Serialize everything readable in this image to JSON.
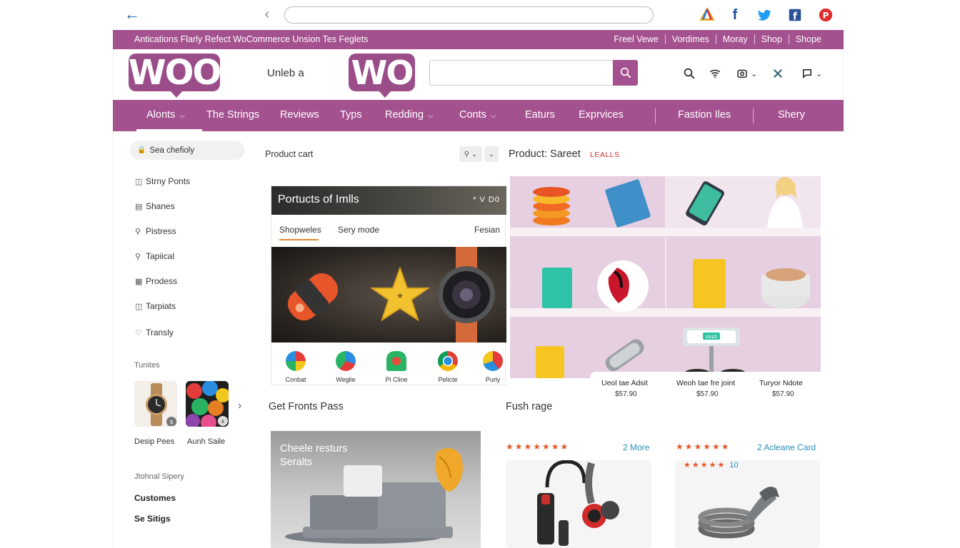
{
  "header": {
    "promo_text": "Antications Flarly Refect WoCommerce Unsion Tes Feglets",
    "top_links": [
      "Freel Vewe",
      "Vordimes",
      "Moray",
      "Shop",
      "Shope"
    ],
    "logo_text": "WOO",
    "logo_mid_text": "WO",
    "tagline": "Unleb a"
  },
  "nav": {
    "items": [
      {
        "label": "Alonts",
        "caret": true
      },
      {
        "label": "The Strings",
        "caret": false
      },
      {
        "label": "Reviews",
        "caret": false
      },
      {
        "label": "Typs",
        "caret": false
      },
      {
        "label": "Redding",
        "caret": true
      },
      {
        "label": "Conts",
        "caret": true
      },
      {
        "label": "Eaturs",
        "caret": false
      },
      {
        "label": "Exprvices",
        "caret": false
      },
      {
        "label": "Fastion Iles",
        "caret": false
      },
      {
        "label": "Shery",
        "caret": false
      }
    ]
  },
  "sidebar": {
    "search_label": "Sea chefioly",
    "items": [
      "Strny Ponts",
      "Shanes",
      "Pistress",
      "Tapiical",
      "Prodess",
      "Tarpiats",
      "Transly"
    ],
    "thumbs_heading": "Tunites",
    "thumbs": [
      {
        "label": "Desip Pees",
        "badge": "$"
      },
      {
        "label": "Aunh Saile",
        "badge": "x"
      }
    ],
    "bottom_heading": "Jtohnal Sipery",
    "bottom_links": [
      "Customes",
      "Se Sitigs"
    ]
  },
  "center": {
    "cart_title": "Product cart",
    "card": {
      "title": "Portucts of Imlls",
      "controls": "* V D0",
      "tabs": [
        "Shopweles",
        "Sery mode",
        "Fesian"
      ],
      "icons": [
        "Conbat",
        "Weglie",
        "Pi Cline",
        "Pelicte",
        "Purly"
      ]
    },
    "section1": "Get Fronts Pass",
    "promo": {
      "line1": "Cheele resturs",
      "line2": "Seralts"
    }
  },
  "right": {
    "title": "Product: Sareet",
    "badge": "LEALLS",
    "screen_text": "$$$D",
    "shelf_labels": [
      {
        "name": "Ueol tae Adsit",
        "price": "$57.90"
      },
      {
        "name": "Weoh tae fre joint",
        "price": "$57.90"
      },
      {
        "name": "Turyor Ndote",
        "price": "$57.90"
      }
    ],
    "section2": "Fush rage",
    "review1": {
      "stars": "★★★★★★★",
      "more": "2 More"
    },
    "review2": {
      "stars": "★★★★★★",
      "more": "2 Acleane Card",
      "sub_stars": "★★★★★",
      "sub_count": "10"
    }
  },
  "colors": {
    "brand_purple": "#a4518f",
    "logo_purple": "#9b4d8a",
    "star_orange": "#e8582a",
    "link_blue": "#2a8fb8",
    "badge_red": "#d0322e"
  },
  "icons": [
    "back-arrow-icon",
    "chevron-left-icon",
    "google-drive-icon",
    "facebook-icon",
    "twitter-icon",
    "facebook-square-icon",
    "pinterest-icon",
    "search-icon",
    "wifi-icon",
    "camera-icon",
    "shuffle-icon",
    "chat-icon"
  ]
}
